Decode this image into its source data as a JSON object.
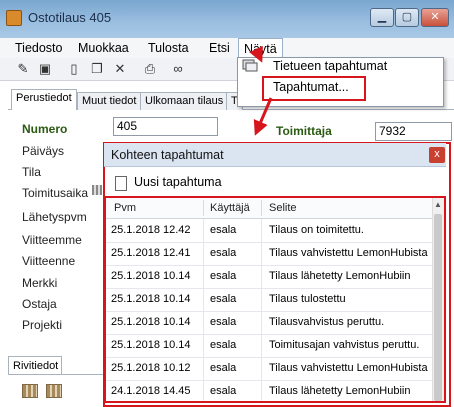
{
  "window": {
    "title": "Ostotilaus 405",
    "minimize": "▁",
    "maximize": "▢",
    "close": "✕"
  },
  "menu": [
    "Tiedosto",
    "Muokkaa",
    "Tulosta",
    "Etsi",
    "Näytä"
  ],
  "tabs": [
    "Perustiedot",
    "Muut tiedot",
    "Ulkomaan tilaus",
    "T"
  ],
  "form": {
    "labels": [
      "Numero",
      "Päiväys",
      "Tila",
      "Toimitusaika",
      "Lähetyspvm",
      "Viitteemme",
      "Viitteenne",
      "Merkki",
      "Ostaja",
      "Projekti"
    ],
    "numero_value": "405",
    "toimittaja_label": "Toimittaja",
    "toimittaja_value": "7932"
  },
  "bottom": {
    "tab": "Rivitiedot"
  },
  "dropdown": {
    "items": [
      "Tietueen tapahtumat",
      "Tapahtumat..."
    ]
  },
  "dialog": {
    "title": "Kohteen tapahtumat",
    "close": "x",
    "new_event": "Uusi tapahtuma",
    "columns": [
      "Pvm",
      "Käyttäjä",
      "Selite"
    ],
    "rows": [
      [
        "25.1.2018 12.42",
        "esala",
        "Tilaus on toimitettu."
      ],
      [
        "25.1.2018 12.41",
        "esala",
        "Tilaus vahvistettu LemonHubista"
      ],
      [
        "25.1.2018 10.14",
        "esala",
        "Tilaus lähetetty LemonHubiin"
      ],
      [
        "25.1.2018 10.14",
        "esala",
        "Tilaus tulostettu"
      ],
      [
        "25.1.2018 10.14",
        "esala",
        "Tilausvahvistus peruttu."
      ],
      [
        "25.1.2018 10.14",
        "esala",
        "Toimitusajan vahvistus peruttu."
      ],
      [
        "25.1.2018 10.12",
        "esala",
        "Tilaus vahvistettu LemonHubista"
      ],
      [
        "24.1.2018 14.45",
        "esala",
        "Tilaus lähetetty LemonHubiin"
      ]
    ]
  },
  "colors": {
    "highlight": "#d7151d",
    "label_green": "#2b5a12"
  }
}
